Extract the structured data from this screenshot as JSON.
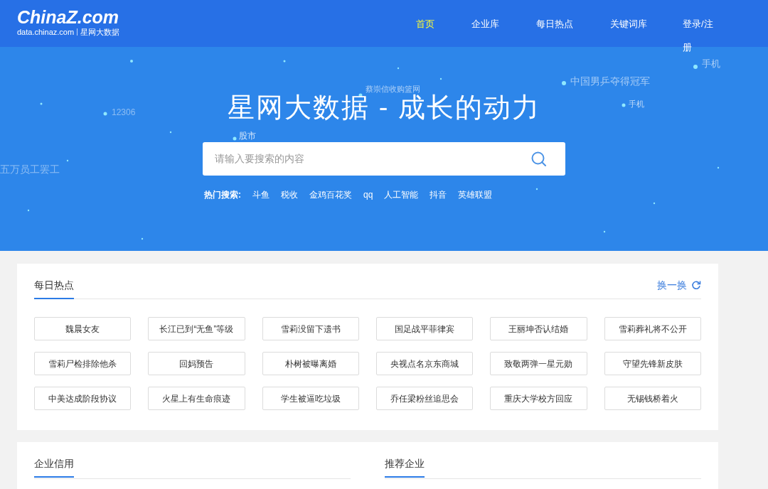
{
  "header": {
    "logo": "ChinaZ.com",
    "logo_subtitle_domain": "data.chinaz.com",
    "logo_subtitle_name": "星网大数据",
    "nav": [
      {
        "label": "首页",
        "selected": true
      },
      {
        "label": "企业库",
        "selected": false
      },
      {
        "label": "每日热点",
        "selected": false
      },
      {
        "label": "关键词库",
        "selected": false
      },
      {
        "label": "登录/注册",
        "selected": false
      }
    ]
  },
  "hero": {
    "title": "星网大数据 - 成长的动力",
    "floating_words": [
      "12306",
      "股市",
      "蔡崇信收购篮网",
      "中国男乒夺得冠军",
      "手机",
      "手机",
      "五万员工罢工"
    ],
    "search": {
      "placeholder": "请输入要搜索的内容"
    },
    "hot_label": "热门搜索:",
    "hot_searches": [
      "斗鱼",
      "税收",
      "金鸡百花奖",
      "qq",
      "人工智能",
      "抖音",
      "英雄联盟"
    ]
  },
  "daily_hot": {
    "title": "每日热点",
    "refresh": "换一换",
    "tags": [
      "魏晨女友",
      "长江已到“无鱼”等级",
      "雪莉没留下遗书",
      "国足战平菲律宾",
      "王丽坤否认结婚",
      "雪莉葬礼将不公开",
      "雪莉尸检排除他杀",
      "回妈预告",
      "朴树被曝离婚",
      "央视点名京东商城",
      "致敬两弹一星元勋",
      "守望先锋新皮肤",
      "中美达成阶段协议",
      "火星上有生命痕迹",
      "学生被逼吃垃圾",
      "乔任梁粉丝追思会",
      "重庆大学校方回应",
      "无锡钱桥着火"
    ]
  },
  "sections": [
    {
      "title": "企业信用"
    },
    {
      "title": "推荐企业"
    }
  ]
}
